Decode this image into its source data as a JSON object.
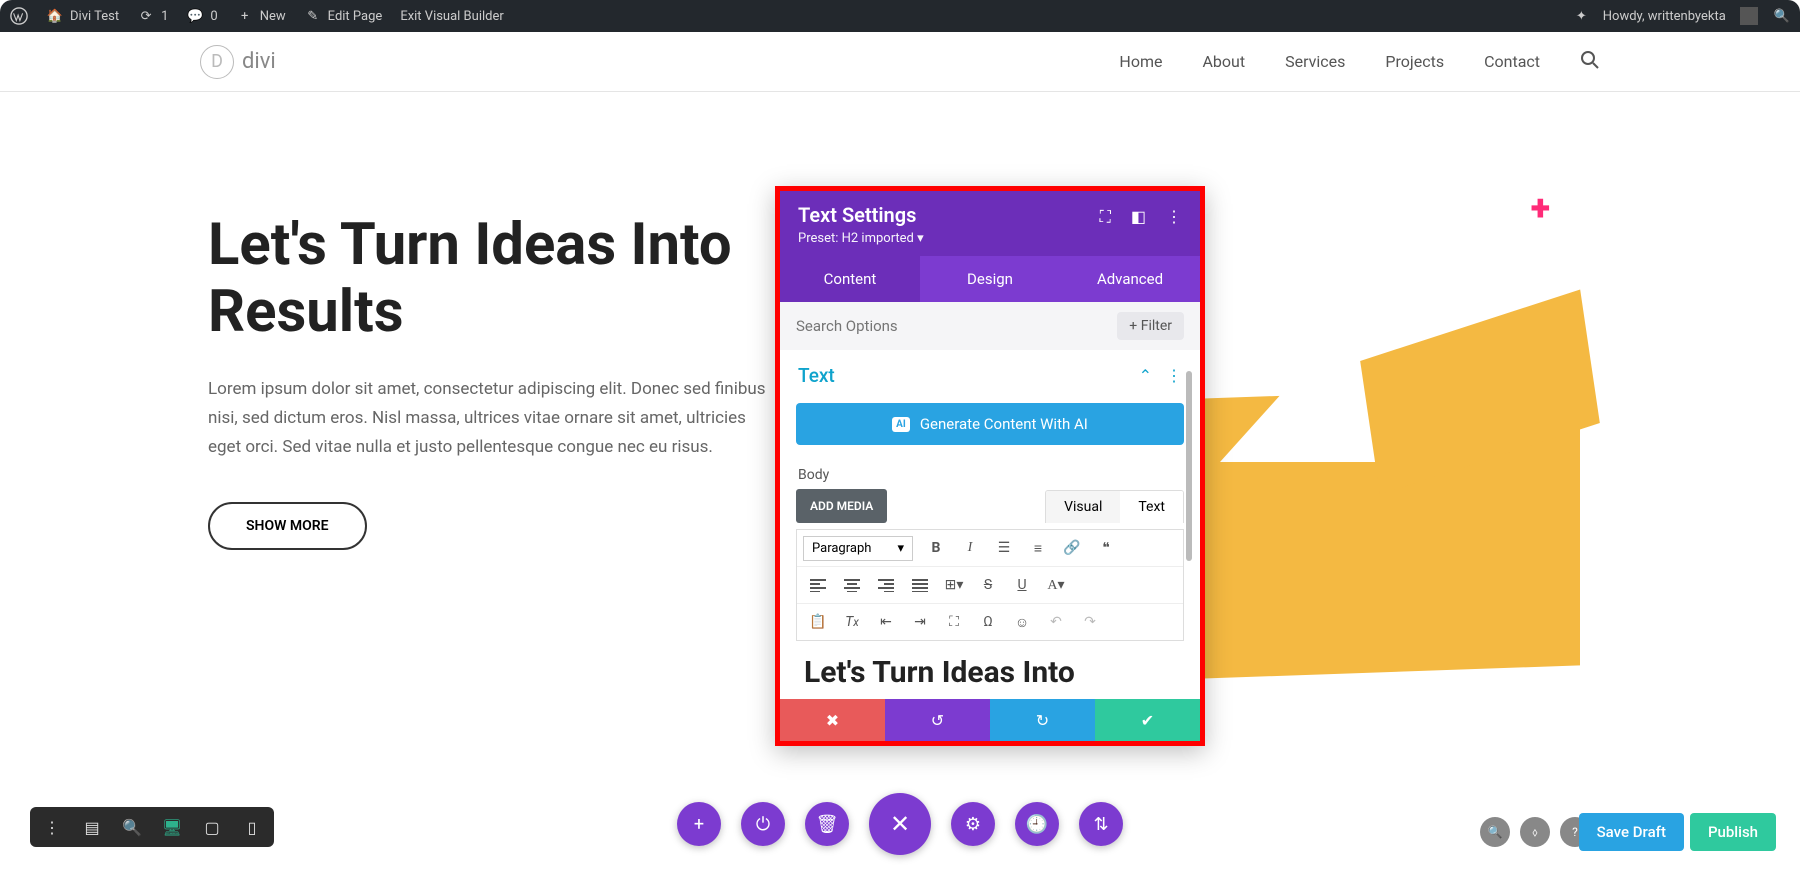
{
  "adminBar": {
    "siteName": "Divi Test",
    "updates": "1",
    "comments": "0",
    "newLabel": "New",
    "editPage": "Edit Page",
    "exitVB": "Exit Visual Builder",
    "greeting": "Howdy, writtenbyekta"
  },
  "header": {
    "logoText": "divi",
    "nav": [
      "Home",
      "About",
      "Services",
      "Projects",
      "Contact"
    ]
  },
  "hero": {
    "title": "Let's Turn Ideas Into Results",
    "body": "Lorem ipsum dolor sit amet, consectetur adipiscing elit. Donec sed finibus nisi, sed dictum eros. Nisl massa, ultrices vitae ornare sit amet, ultricies eget orci. Sed vitae nulla et justo pellentesque congue nec eu risus.",
    "cta": "SHOW MORE"
  },
  "panel": {
    "title": "Text Settings",
    "preset": "Preset: H2 imported ▾",
    "tabs": {
      "content": "Content",
      "design": "Design",
      "advanced": "Advanced"
    },
    "searchPlaceholder": "Search Options",
    "filter": "Filter",
    "section": "Text",
    "aiBtn": "Generate Content With AI",
    "aiBadge": "AI",
    "bodyLabel": "Body",
    "addMedia": "ADD MEDIA",
    "visual": "Visual",
    "textTab": "Text",
    "paragraph": "Paragraph",
    "editorPreview": "Let's Turn Ideas Into"
  },
  "actions": {
    "saveDraft": "Save Draft",
    "publish": "Publish"
  }
}
